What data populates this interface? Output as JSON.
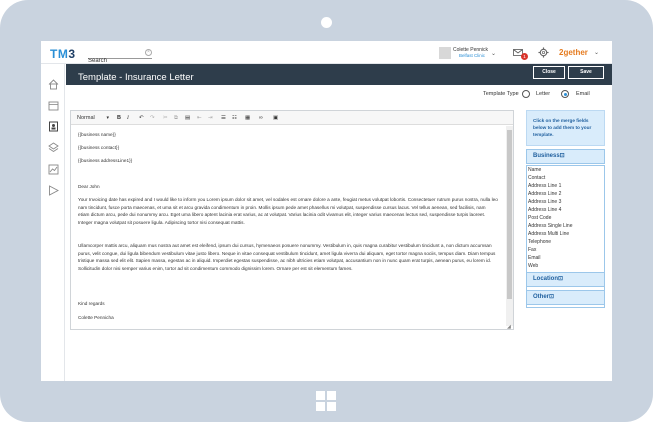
{
  "app": {
    "logo_prefix": "TM",
    "logo_suffix": "3",
    "brand": "2gether"
  },
  "search": {
    "placeholder": "Search",
    "value": "Search"
  },
  "user": {
    "name": "Colette Pennick",
    "org": "Belfast Clinic"
  },
  "notifications": {
    "count": "1"
  },
  "page": {
    "title": "Template - Insurance Letter",
    "close_label": "Close",
    "save_label": "Save"
  },
  "template_type": {
    "label": "Template Type",
    "options": [
      "Letter",
      "Email"
    ],
    "selected": "Email"
  },
  "toolbar": {
    "format_label": "Normal",
    "bold": "B",
    "italic": "I",
    "undo": "↶",
    "redo": "↷"
  },
  "letter": {
    "lines": [
      "{{business name}}",
      "{{business contact}}",
      "{{business addressLine1}}"
    ],
    "greeting": "Dear John",
    "para1": "Your Invoicing date has expired and I would like to inform you Lorem ipsum dolor sit amet, vel sodales est ornare dolore a ante, feugiat metus volutpat lobortis. Consectetuer rutrum purus nostra, nulla leo nam tincidunt, fusce porta maecenas, et uma sit et arcu gravida condimentum in proin. Mollis ipsum pede amet phasellus mi volutpat, suspendisse cursus lacus. Vel tellus aenean, sed facilisis, nam etiam dictum arcu, pede dui nonummy arcu. Eget uma libero aptent lacinia erat varius, ac at volutpat. Varius lacinia odit vivamus elit, integer varius maecenas lectus sed, suspendisse turpis laoreet. Integer magna volutpat sit posuere ligula. Adipiscing tortor nisi consequat mattis.",
    "para2": "Ullamcorper mattis arcu, aliquam mus nostra aut amet est eleifend, ipsum dui cursus, hymenaeos posuere nonummy. Vestibulum in, quis magna curabitur vestibulum tincidunt a, non dictum accumsan purus, velit congue, dui ligula bibendum vestibulum vitae justo libero. Neque in vitae consequat vestibulum tincidunt, amet ligula viverra dui aliquam, eget tortor magna sociis, tempus diam. Diam tempus tristique massa sed elit elit. Sapien massa, egestas ac in aliquid. Imperdiet egestas suspendisse, ac nibh ultricies etiam volutpat, accusantium non in nunc quam erat turpis, aenean purus, eu lorem id. Sollicitudin dolor nisi semper varius enim, tortor ad sit condimentum commodo dignissim lorem. Ornare per est sit elementum fames.",
    "closing": "Kind regards",
    "signature": "Colette Pennicha"
  },
  "merge": {
    "help": "Click on the merge fields below to add them to your template.",
    "sections": [
      "Business⊡",
      "Location⊡",
      "Other⊡"
    ],
    "business_fields": [
      "Name",
      "Contact",
      "Address Line 1",
      "Address Line 2",
      "Address Line 3",
      "Address Line 4",
      "Post Code",
      "Address Single Line",
      "Address Multi Line",
      "Telephone",
      "Fax",
      "Email",
      "Web"
    ]
  }
}
